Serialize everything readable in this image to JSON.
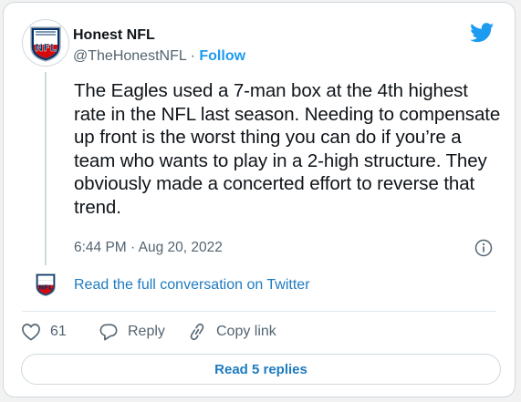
{
  "author": {
    "name": "Honest NFL",
    "handle": "@TheHonestNFL",
    "separator": "·",
    "follow_label": "Follow",
    "avatar_text": "NFL"
  },
  "tweet": {
    "text": "The Eagles used a 7-man box at the 4th highest rate in the NFL last season. Needing to compensate up front is the worst thing you can do if you’re a team who wants to play in a 2-high structure. They obviously made a concerted effort to reverse that trend.",
    "timestamp": "6:44 PM · Aug 20, 2022"
  },
  "conversation_link": "Read the full conversation on Twitter",
  "actions": {
    "likes_count": "61",
    "reply_label": "Reply",
    "copy_link_label": "Copy link"
  },
  "replies_button": "Read 5 replies",
  "colors": {
    "accent": "#1d9bf0",
    "link": "#1d7bbf",
    "text": "#0f1419",
    "muted": "#536471",
    "border": "#cfd9de"
  },
  "icons": [
    "nfl-shield-icon",
    "twitter-bird-icon",
    "info-icon",
    "heart-icon",
    "reply-bubble-icon",
    "link-icon"
  ]
}
